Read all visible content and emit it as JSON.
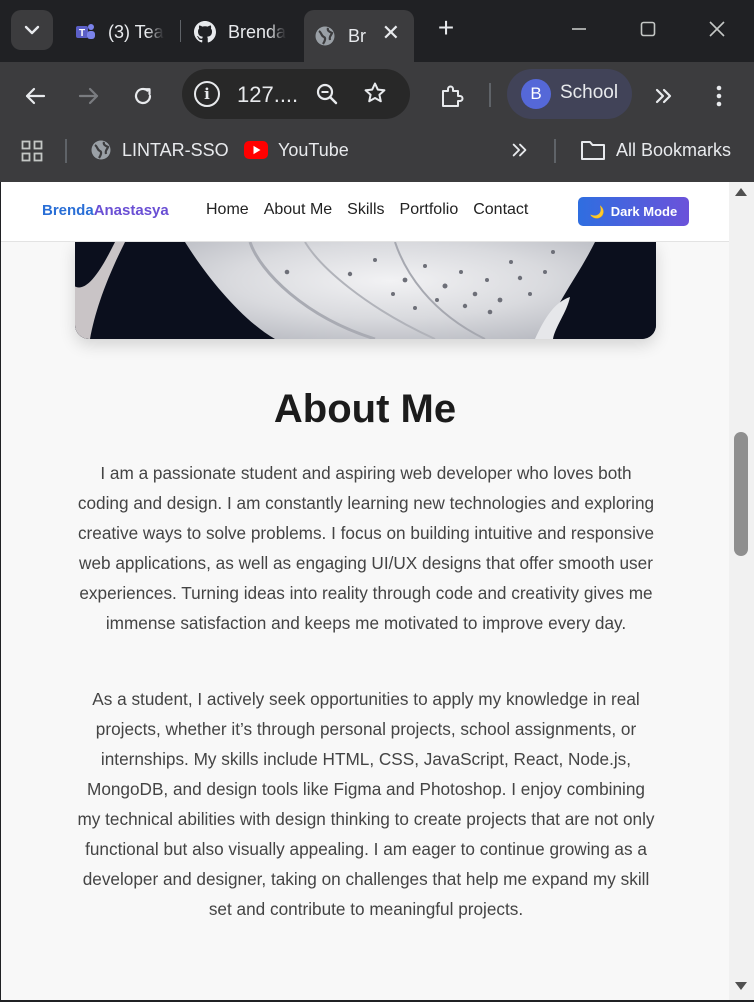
{
  "browser": {
    "tabs": [
      {
        "title": "(3) Tea",
        "icon": "teams-icon"
      },
      {
        "title": "Brenda",
        "icon": "github-icon"
      },
      {
        "title": "Br",
        "icon": "globe-icon",
        "active": true
      }
    ],
    "address": "127....",
    "profile": {
      "initial": "B",
      "name": "School"
    },
    "bookmarks": [
      {
        "label": "LINTAR-SSO",
        "icon": "globe-icon"
      },
      {
        "label": "YouTube",
        "icon": "youtube-icon"
      }
    ],
    "all_bookmarks_label": "All Bookmarks"
  },
  "site": {
    "logo": {
      "first": "Brenda",
      "last": "Anastasya"
    },
    "nav": [
      "Home",
      "About Me",
      "Skills",
      "Portfolio",
      "Contact"
    ],
    "dark_mode_label": "Dark Mode",
    "dark_mode_icon": "moon-icon",
    "about": {
      "title": "About Me",
      "paragraphs": [
        "I am a passionate student and aspiring web developer who loves both coding and design. I am constantly learning new technologies and exploring creative ways to solve problems. I focus on building intuitive and responsive web applications, as well as engaging UI/UX designs that offer smooth user experiences. Turning ideas into reality through code and creativity gives me immense satisfaction and keeps me motivated to improve every day.",
        "As a student, I actively seek opportunities to apply my knowledge in real projects, whether it’s through personal projects, school assignments, or internships. My skills include HTML, CSS, JavaScript, React, Node.js, MongoDB, and design tools like Figma and Photoshop. I enjoy combining my technical abilities with design thinking to create projects that are not only functional but also visually appealing. I am eager to continue growing as a developer and designer, taking on challenges that help me expand my skill set and contribute to meaningful projects."
      ]
    }
  },
  "colors": {
    "chrome_bg": "#202124",
    "toolbar_bg": "#3c3c3e",
    "accent_blue": "#2a6fd6",
    "accent_purple": "#6a4fd4",
    "page_bg": "#f8f8f8"
  }
}
